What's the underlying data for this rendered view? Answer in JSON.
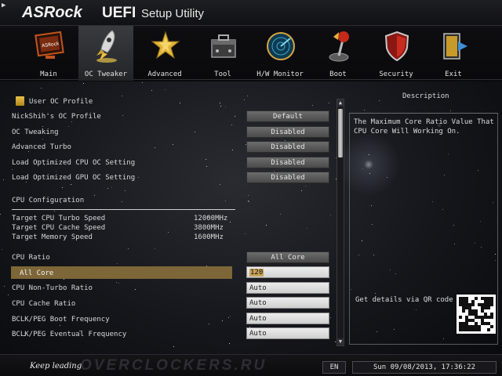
{
  "header": {
    "brand": "ASRock",
    "product": "UEFI",
    "subtitle": "Setup Utility"
  },
  "tabs": [
    {
      "label": "Main",
      "icon": "monitor-icon",
      "active": false
    },
    {
      "label": "OC Tweaker",
      "icon": "rocket-icon",
      "active": true
    },
    {
      "label": "Advanced",
      "icon": "star-icon",
      "active": false
    },
    {
      "label": "Tool",
      "icon": "toolbox-icon",
      "active": false
    },
    {
      "label": "H/W Monitor",
      "icon": "radar-icon",
      "active": false
    },
    {
      "label": "Boot",
      "icon": "joystick-icon",
      "active": false
    },
    {
      "label": "Security",
      "icon": "shield-icon",
      "active": false
    },
    {
      "label": "Exit",
      "icon": "exit-door-icon",
      "active": false
    }
  ],
  "settings": {
    "profile_header": "User OC Profile",
    "profile_name": "NickShih's OC Profile",
    "profile_value": "Default",
    "oc_tweaking": "OC Tweaking",
    "oc_tweaking_value": "Disabled",
    "advanced_turbo": "Advanced Turbo",
    "advanced_turbo_value": "Disabled",
    "load_cpu": "Load Optimized CPU OC Setting",
    "load_cpu_value": "Disabled",
    "load_gpu": "Load Optimized GPU OC Setting",
    "load_gpu_value": "Disabled",
    "cpu_config": "CPU Configuration",
    "target_turbo": "Target CPU Turbo Speed",
    "target_turbo_value": "12000MHz",
    "target_cache": "Target CPU Cache Speed",
    "target_cache_value": "3800MHz",
    "target_memory": "Target Memory Speed",
    "target_memory_value": "1600MHz",
    "cpu_ratio": "CPU Ratio",
    "cpu_ratio_value": "All Core",
    "all_core": "All Core",
    "all_core_value": "120",
    "non_turbo": "CPU Non-Turbo Ratio",
    "non_turbo_value": "Auto",
    "cache_ratio": "CPU Cache Ratio",
    "cache_ratio_value": "Auto",
    "bclk_boot": "BCLK/PEG Boot Frequency",
    "bclk_boot_value": "Auto",
    "bclk_eventual": "BCLK/PEG Eventual Frequency",
    "bclk_eventual_value": "Auto"
  },
  "description": {
    "title": "Description",
    "text": "The Maximum Core Ratio Value That CPU Core Will Working On.",
    "qr_label": "Get details via QR code"
  },
  "footer": {
    "slogan": "Keep leading",
    "watermark": "OVERCLOCKERS.RU",
    "language": "EN",
    "datetime": "Sun 09/08/2013, 17:36:22"
  },
  "colors": {
    "highlight": "#7d6638",
    "button": "#5a5a5a",
    "input": "#dcdcdc"
  }
}
